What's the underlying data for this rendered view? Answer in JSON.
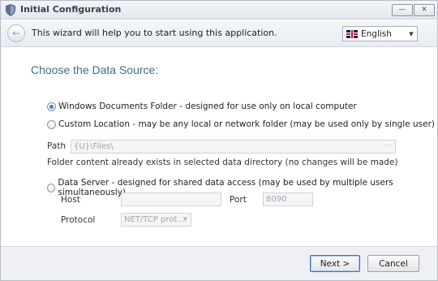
{
  "window": {
    "title": "Initial Configuration",
    "minimize_glyph": "—",
    "close_glyph": "✕",
    "icon": "shield-icon"
  },
  "header": {
    "back_glyph": "←",
    "text": "This wizard will help you to start using this application.",
    "language": "English",
    "language_flag": "uk-flag-icon"
  },
  "main": {
    "heading": "Choose the Data Source:",
    "options": [
      {
        "label": "Windows Documents Folder - designed for use only on local computer",
        "checked": true
      },
      {
        "label": "Custom Location - may be any local or network folder (may be used only by single user)",
        "checked": false
      },
      {
        "label": "Data Server - designed for shared data access (may be used by multiple users simultaneously)",
        "checked": false
      }
    ],
    "path": {
      "label": "Path",
      "value": "{U}\\Files\\",
      "browse": "···"
    },
    "info": "Folder content already exists in selected data directory (no changes will be made)",
    "host": {
      "label": "Host",
      "value": ""
    },
    "port": {
      "label": "Port",
      "value": "8090"
    },
    "protocol": {
      "label": "Protocol",
      "value": "NET/TCP prot..."
    }
  },
  "footer": {
    "next_label": "Next >",
    "cancel_label": "Cancel"
  },
  "colors": {
    "heading": "#3d6c8f",
    "accent": "#3d73b5"
  }
}
